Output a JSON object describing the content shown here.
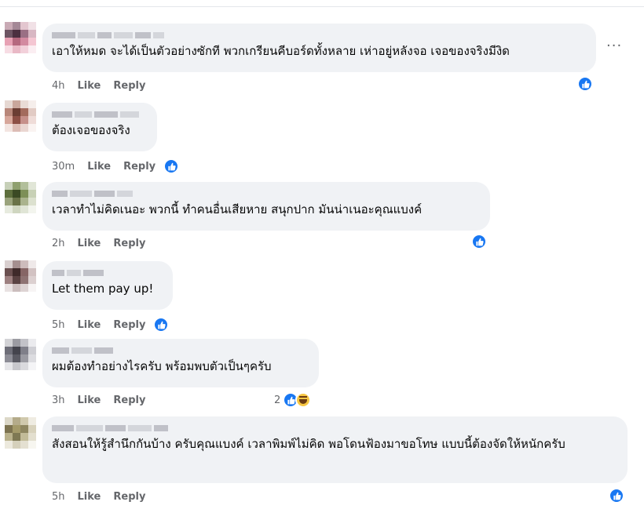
{
  "comments": [
    {
      "time": "4h",
      "like_label": "Like",
      "reply_label": "Reply",
      "text": "เอาให้หมด จะได้เป็นตัวอย่างซักที พวกเกรียนคีบอร์ดทั้งหลาย เห่าอยู่หลังจอ เจอของจริงมีงิด",
      "reactions": [
        "like"
      ]
    },
    {
      "time": "30m",
      "like_label": "Like",
      "reply_label": "Reply",
      "text": "ต้องเจอของจริง",
      "reactions": [
        "like"
      ]
    },
    {
      "time": "2h",
      "like_label": "Like",
      "reply_label": "Reply",
      "text": "เวลาทำไม่คิดเนอะ พวกนี้ ทำคนอื่นเสียหาย สนุกปาก มันน่าเนอะคุณแบงค์",
      "reactions": [
        "like"
      ]
    },
    {
      "time": "5h",
      "like_label": "Like",
      "reply_label": "Reply",
      "text": "Let them pay up!",
      "reactions": [
        "like"
      ]
    },
    {
      "time": "3h",
      "like_label": "Like",
      "reply_label": "Reply",
      "text": "ผมต้องทำอย่างไรครับ พร้อมพบตัวเป็นๆครับ",
      "reaction_count": "2",
      "reactions": [
        "like",
        "haha"
      ]
    },
    {
      "time": "5h",
      "like_label": "Like",
      "reply_label": "Reply",
      "text": "สังสอนให้รู้สำนึกกันบ้าง ครับคุณแบงค์ เวลาพิมพ์ไม่คิด พอโดนฟ้องมาขอโทษ แบบนี้ต้องจัดให้หนักครับ",
      "reactions": [
        "like"
      ]
    }
  ],
  "more_options": "···",
  "icons": [
    "like-icon",
    "haha-icon",
    "more-options-icon"
  ],
  "colors": {
    "bubble": "#f0f2f5",
    "like_blue": "#1877f2",
    "meta_gray": "#65676b"
  }
}
